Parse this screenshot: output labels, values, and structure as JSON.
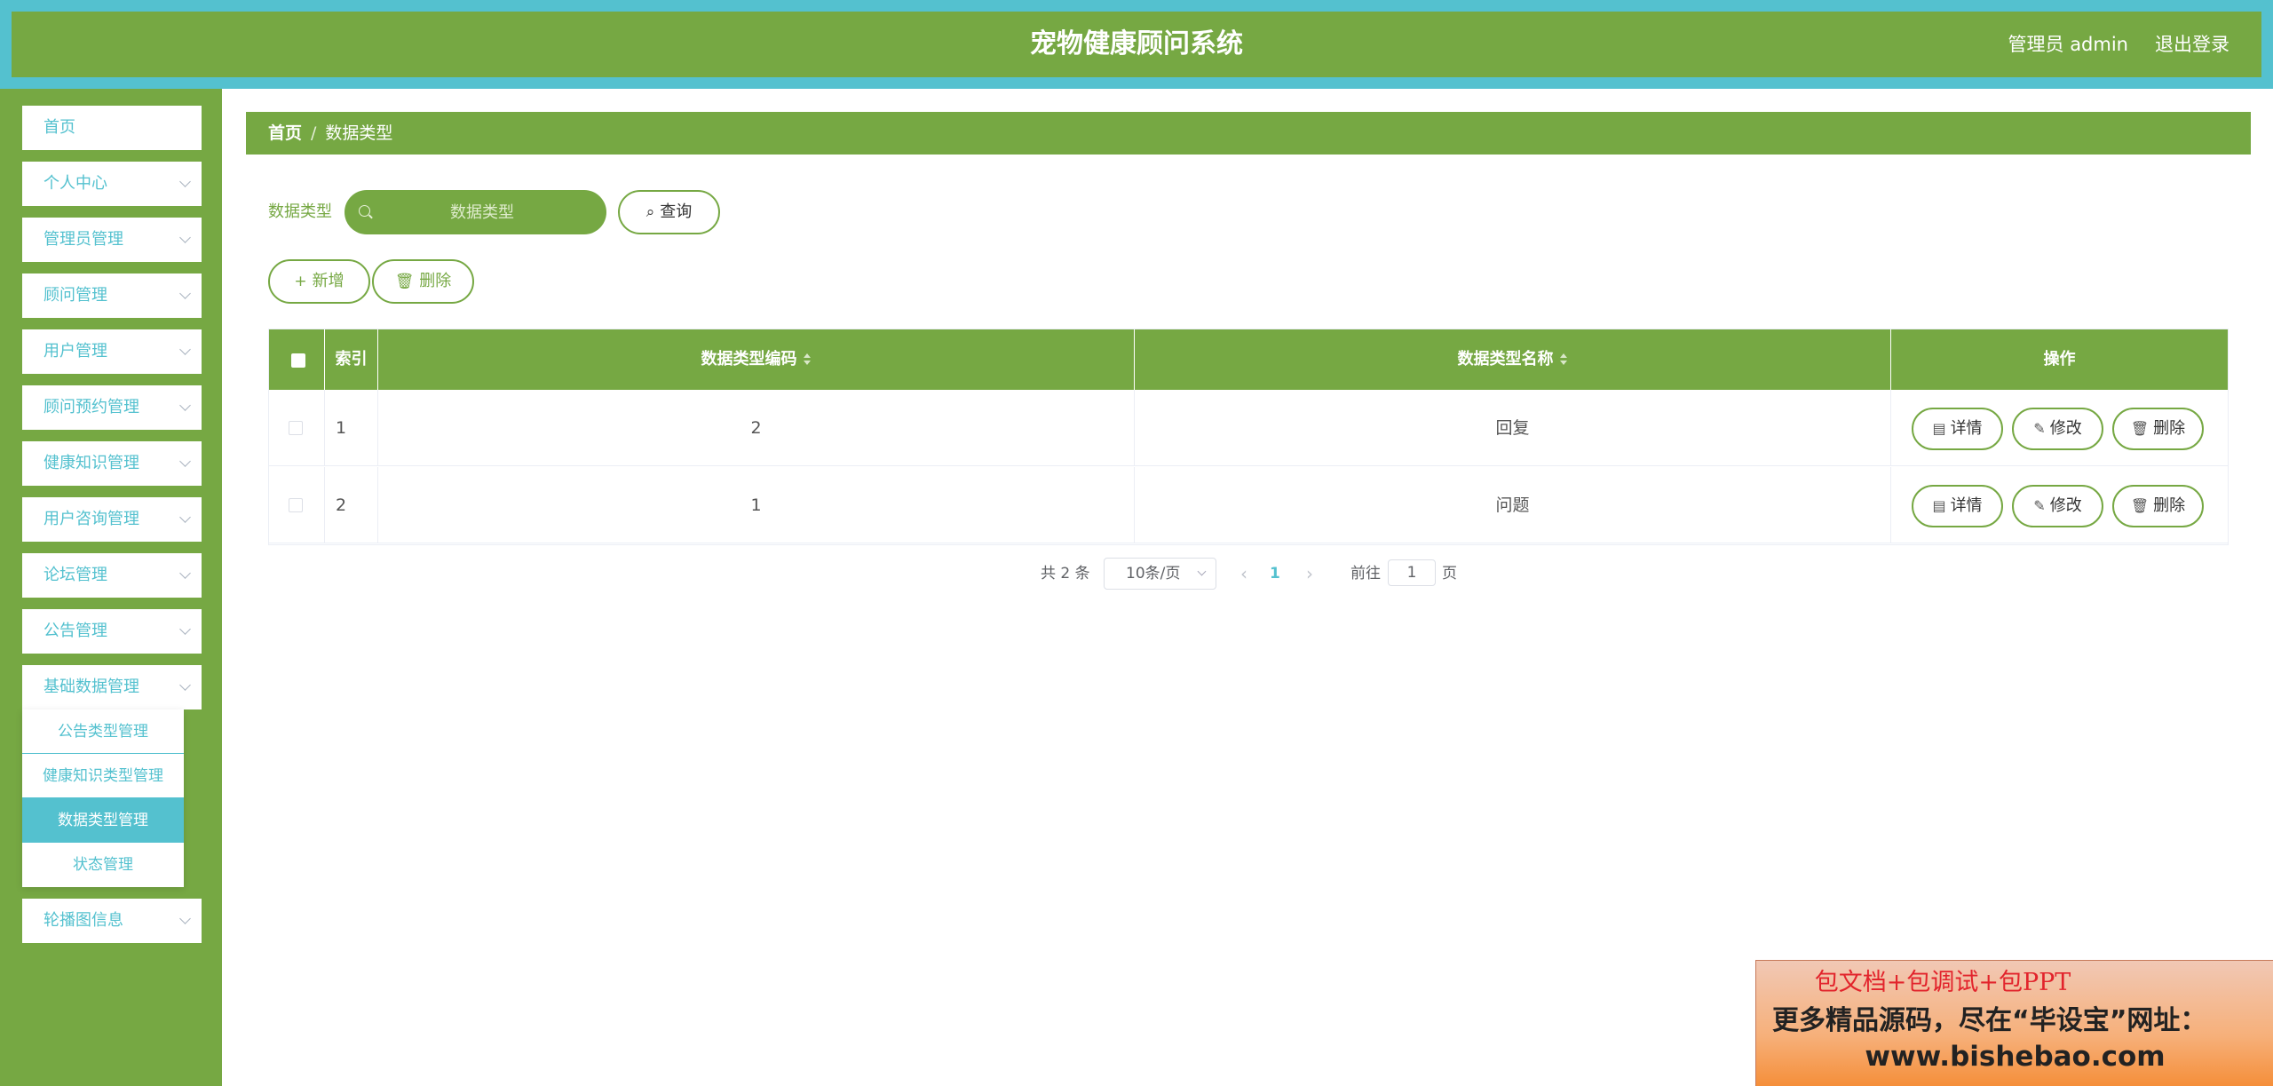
{
  "header": {
    "title": "宠物健康顾问系统",
    "user": "管理员 admin",
    "logout": "退出登录"
  },
  "sidebar": {
    "items": [
      {
        "label": "首页"
      },
      {
        "label": "个人中心"
      },
      {
        "label": "管理员管理"
      },
      {
        "label": "顾问管理"
      },
      {
        "label": "用户管理"
      },
      {
        "label": "顾问预约管理"
      },
      {
        "label": "健康知识管理"
      },
      {
        "label": "用户咨询管理"
      },
      {
        "label": "论坛管理"
      },
      {
        "label": "公告管理"
      },
      {
        "label": "基础数据管理"
      },
      {
        "label": "轮播图信息"
      }
    ],
    "submenu": [
      {
        "label": "公告类型管理"
      },
      {
        "label": "健康知识类型管理"
      },
      {
        "label": "数据类型管理",
        "active": true
      },
      {
        "label": "状态管理"
      }
    ]
  },
  "breadcrumb": {
    "home": "首页",
    "separator": "/",
    "current": "数据类型"
  },
  "search": {
    "label": "数据类型",
    "placeholder": "数据类型",
    "query_button": "查询"
  },
  "toolbar": {
    "add_label": "新增",
    "delete_label": "删除"
  },
  "table": {
    "columns": [
      "索引",
      "数据类型编码",
      "数据类型名称",
      "操作"
    ],
    "rows": [
      {
        "index": "1",
        "code": "2",
        "name": "回复"
      },
      {
        "index": "2",
        "code": "1",
        "name": "问题"
      }
    ],
    "actions": {
      "detail": "详情",
      "edit": "修改",
      "delete": "删除"
    }
  },
  "pagination": {
    "total_text": "共 2 条",
    "page_size": "10条/页",
    "current_page": "1",
    "goto_prefix": "前往",
    "goto_value": "1",
    "goto_suffix": "页"
  },
  "ad": {
    "line1": "包文档+包调试+包PPT",
    "line2": "更多精品源码，尽在“毕设宝”网址：",
    "line3": "www.bishebao.com"
  },
  "colors": {
    "primary_green": "#76a843",
    "accent_cyan": "#54c1cf"
  }
}
